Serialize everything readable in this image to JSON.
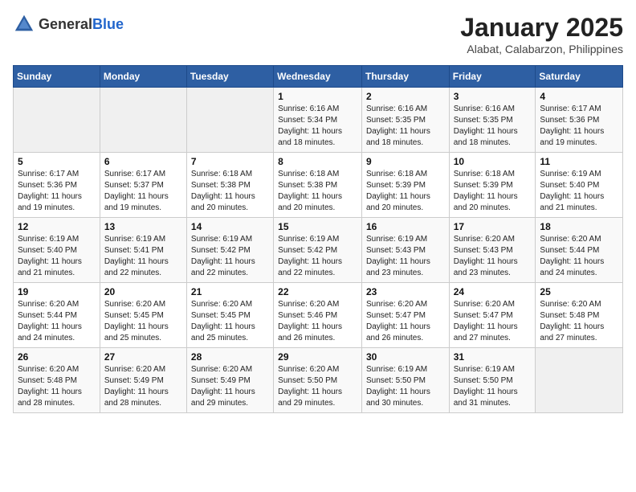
{
  "header": {
    "logo_general": "General",
    "logo_blue": "Blue",
    "month_title": "January 2025",
    "location": "Alabat, Calabarzon, Philippines"
  },
  "columns": [
    "Sunday",
    "Monday",
    "Tuesday",
    "Wednesday",
    "Thursday",
    "Friday",
    "Saturday"
  ],
  "weeks": [
    [
      {
        "day": "",
        "info": ""
      },
      {
        "day": "",
        "info": ""
      },
      {
        "day": "",
        "info": ""
      },
      {
        "day": "1",
        "info": "Sunrise: 6:16 AM\nSunset: 5:34 PM\nDaylight: 11 hours and 18 minutes."
      },
      {
        "day": "2",
        "info": "Sunrise: 6:16 AM\nSunset: 5:35 PM\nDaylight: 11 hours and 18 minutes."
      },
      {
        "day": "3",
        "info": "Sunrise: 6:16 AM\nSunset: 5:35 PM\nDaylight: 11 hours and 18 minutes."
      },
      {
        "day": "4",
        "info": "Sunrise: 6:17 AM\nSunset: 5:36 PM\nDaylight: 11 hours and 19 minutes."
      }
    ],
    [
      {
        "day": "5",
        "info": "Sunrise: 6:17 AM\nSunset: 5:36 PM\nDaylight: 11 hours and 19 minutes."
      },
      {
        "day": "6",
        "info": "Sunrise: 6:17 AM\nSunset: 5:37 PM\nDaylight: 11 hours and 19 minutes."
      },
      {
        "day": "7",
        "info": "Sunrise: 6:18 AM\nSunset: 5:38 PM\nDaylight: 11 hours and 20 minutes."
      },
      {
        "day": "8",
        "info": "Sunrise: 6:18 AM\nSunset: 5:38 PM\nDaylight: 11 hours and 20 minutes."
      },
      {
        "day": "9",
        "info": "Sunrise: 6:18 AM\nSunset: 5:39 PM\nDaylight: 11 hours and 20 minutes."
      },
      {
        "day": "10",
        "info": "Sunrise: 6:18 AM\nSunset: 5:39 PM\nDaylight: 11 hours and 20 minutes."
      },
      {
        "day": "11",
        "info": "Sunrise: 6:19 AM\nSunset: 5:40 PM\nDaylight: 11 hours and 21 minutes."
      }
    ],
    [
      {
        "day": "12",
        "info": "Sunrise: 6:19 AM\nSunset: 5:40 PM\nDaylight: 11 hours and 21 minutes."
      },
      {
        "day": "13",
        "info": "Sunrise: 6:19 AM\nSunset: 5:41 PM\nDaylight: 11 hours and 22 minutes."
      },
      {
        "day": "14",
        "info": "Sunrise: 6:19 AM\nSunset: 5:42 PM\nDaylight: 11 hours and 22 minutes."
      },
      {
        "day": "15",
        "info": "Sunrise: 6:19 AM\nSunset: 5:42 PM\nDaylight: 11 hours and 22 minutes."
      },
      {
        "day": "16",
        "info": "Sunrise: 6:19 AM\nSunset: 5:43 PM\nDaylight: 11 hours and 23 minutes."
      },
      {
        "day": "17",
        "info": "Sunrise: 6:20 AM\nSunset: 5:43 PM\nDaylight: 11 hours and 23 minutes."
      },
      {
        "day": "18",
        "info": "Sunrise: 6:20 AM\nSunset: 5:44 PM\nDaylight: 11 hours and 24 minutes."
      }
    ],
    [
      {
        "day": "19",
        "info": "Sunrise: 6:20 AM\nSunset: 5:44 PM\nDaylight: 11 hours and 24 minutes."
      },
      {
        "day": "20",
        "info": "Sunrise: 6:20 AM\nSunset: 5:45 PM\nDaylight: 11 hours and 25 minutes."
      },
      {
        "day": "21",
        "info": "Sunrise: 6:20 AM\nSunset: 5:45 PM\nDaylight: 11 hours and 25 minutes."
      },
      {
        "day": "22",
        "info": "Sunrise: 6:20 AM\nSunset: 5:46 PM\nDaylight: 11 hours and 26 minutes."
      },
      {
        "day": "23",
        "info": "Sunrise: 6:20 AM\nSunset: 5:47 PM\nDaylight: 11 hours and 26 minutes."
      },
      {
        "day": "24",
        "info": "Sunrise: 6:20 AM\nSunset: 5:47 PM\nDaylight: 11 hours and 27 minutes."
      },
      {
        "day": "25",
        "info": "Sunrise: 6:20 AM\nSunset: 5:48 PM\nDaylight: 11 hours and 27 minutes."
      }
    ],
    [
      {
        "day": "26",
        "info": "Sunrise: 6:20 AM\nSunset: 5:48 PM\nDaylight: 11 hours and 28 minutes."
      },
      {
        "day": "27",
        "info": "Sunrise: 6:20 AM\nSunset: 5:49 PM\nDaylight: 11 hours and 28 minutes."
      },
      {
        "day": "28",
        "info": "Sunrise: 6:20 AM\nSunset: 5:49 PM\nDaylight: 11 hours and 29 minutes."
      },
      {
        "day": "29",
        "info": "Sunrise: 6:20 AM\nSunset: 5:50 PM\nDaylight: 11 hours and 29 minutes."
      },
      {
        "day": "30",
        "info": "Sunrise: 6:19 AM\nSunset: 5:50 PM\nDaylight: 11 hours and 30 minutes."
      },
      {
        "day": "31",
        "info": "Sunrise: 6:19 AM\nSunset: 5:50 PM\nDaylight: 11 hours and 31 minutes."
      },
      {
        "day": "",
        "info": ""
      }
    ]
  ]
}
